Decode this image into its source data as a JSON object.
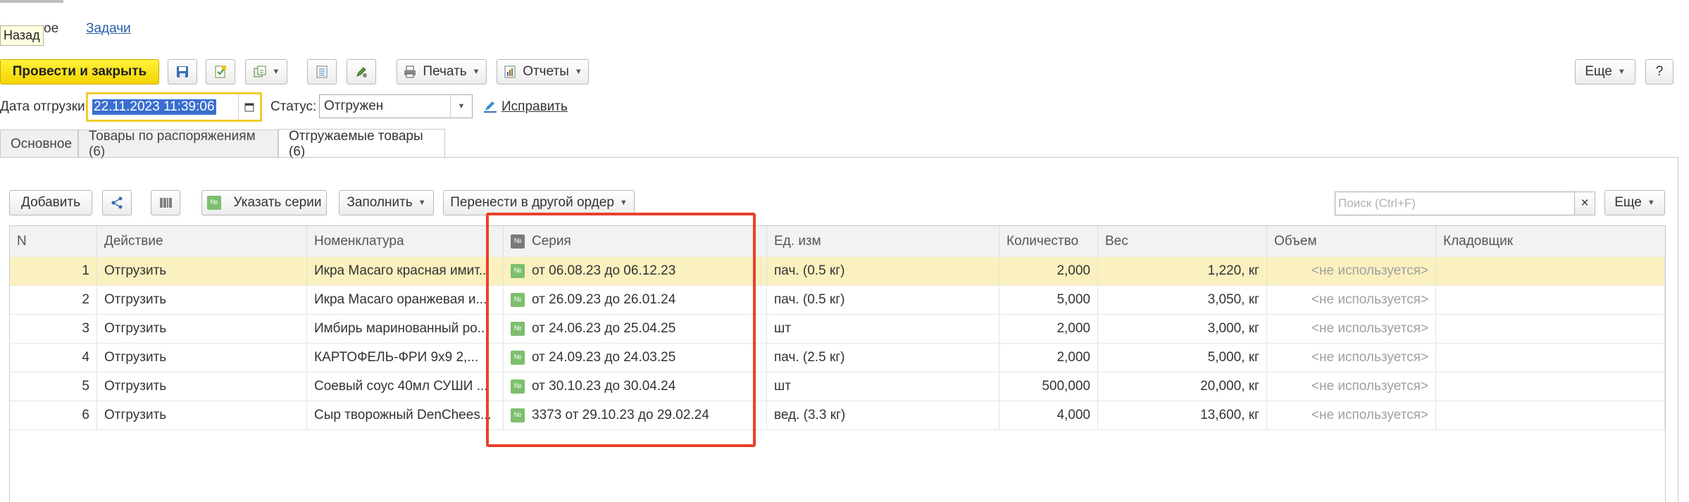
{
  "nav": {
    "tab1": "Основное",
    "tab1_visible": "ое",
    "tab2": "Задачи"
  },
  "tooltip": "Назад",
  "toolbar": {
    "post_close": "Провести и закрыть",
    "print": "Печать",
    "reports": "Отчеты",
    "more": "Еще",
    "help": "?"
  },
  "fields": {
    "ship_date_label": "Дата отгрузки:",
    "ship_date_value": "22.11.2023 11:39:06",
    "status_label": "Статус:",
    "status_value": "Отгружен",
    "fix_link": "Исправить"
  },
  "tabs": [
    {
      "label": "Основное"
    },
    {
      "label": "Товары по распоряжениям (6)"
    },
    {
      "label": "Отгружаемые товары (6)"
    }
  ],
  "table_toolbar": {
    "add": "Добавить",
    "specify_series": "Указать серии",
    "fill": "Заполнить",
    "move": "Перенести в другой ордер",
    "search_placeholder": "Поиск (Ctrl+F)",
    "clear": "×",
    "more": "Еще"
  },
  "columns": [
    "N",
    "Действие",
    "Номенклатура",
    "Серия",
    "Ед. изм",
    "Количество",
    "Вес",
    "Объем",
    "Кладовщик"
  ],
  "rows": [
    {
      "n": "1",
      "action": "Отгрузить",
      "item": "Икра Масаго красная имит...",
      "series": "от 06.08.23 до 06.12.23",
      "unit": "пач. (0.5 кг)",
      "qty": "2,000",
      "weight": "1,220, кг",
      "volume": "<не используется>",
      "keeper": ""
    },
    {
      "n": "2",
      "action": "Отгрузить",
      "item": "Икра Масаго оранжевая и...",
      "series": "от 26.09.23 до 26.01.24",
      "unit": "пач. (0.5 кг)",
      "qty": "5,000",
      "weight": "3,050, кг",
      "volume": "<не используется>",
      "keeper": ""
    },
    {
      "n": "3",
      "action": "Отгрузить",
      "item": "Имбирь маринованный ро...",
      "series": "от 24.06.23 до 25.04.25",
      "unit": "шт",
      "qty": "2,000",
      "weight": "3,000, кг",
      "volume": "<не используется>",
      "keeper": ""
    },
    {
      "n": "4",
      "action": "Отгрузить",
      "item": "КАРТОФЕЛЬ-ФРИ 9х9 2,...",
      "series": "от 24.09.23 до 24.03.25",
      "unit": "пач. (2.5 кг)",
      "qty": "2,000",
      "weight": "5,000, кг",
      "volume": "<не используется>",
      "keeper": ""
    },
    {
      "n": "5",
      "action": "Отгрузить",
      "item": "Соевый соус 40мл СУШИ ...",
      "series": "от 30.10.23 до 30.04.24",
      "unit": "шт",
      "qty": "500,000",
      "weight": "20,000, кг",
      "volume": "<не используется>",
      "keeper": ""
    },
    {
      "n": "6",
      "action": "Отгрузить",
      "item": "Сыр творожный DenChees...",
      "series": "3373 от 29.10.23 до 29.02.24",
      "unit": "вед. (3.3 кг)",
      "qty": "4,000",
      "weight": "13,600, кг",
      "volume": "<не используется>",
      "keeper": ""
    }
  ],
  "colors": {
    "primary_button": "#f5d400",
    "selected_row": "#fbf0bf",
    "highlight_box": "#e8412c",
    "link": "#2b5ea8",
    "series_icon": "#7dbf6e"
  }
}
